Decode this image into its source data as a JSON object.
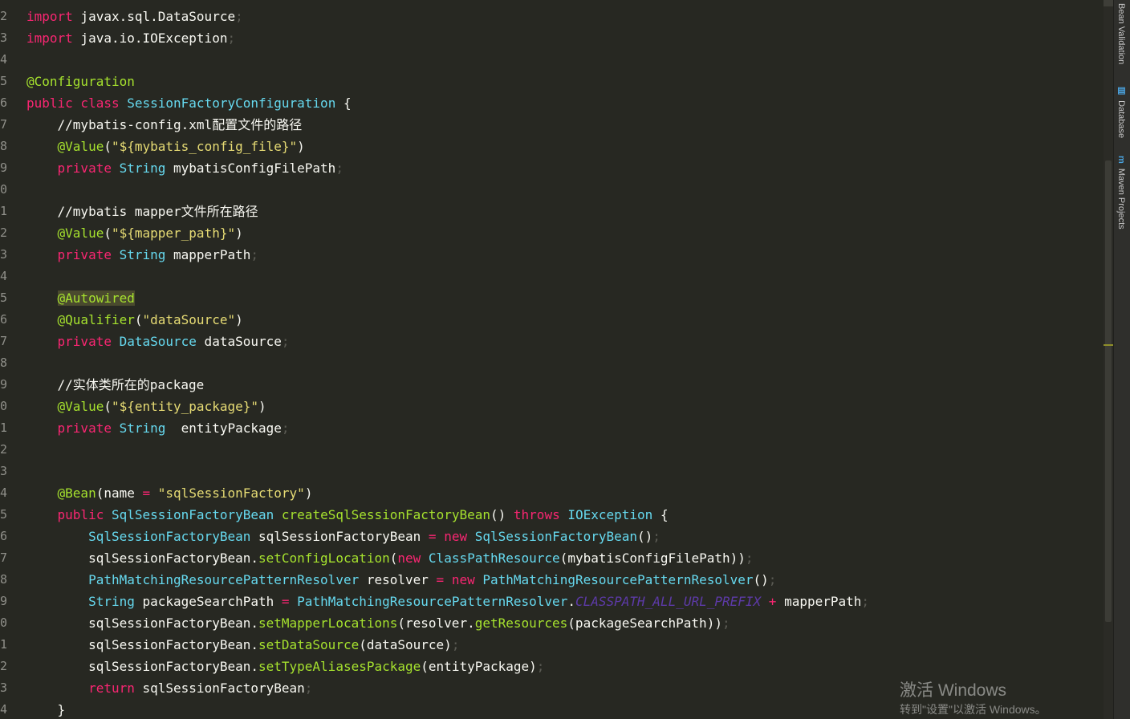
{
  "editor": {
    "lines": [
      {
        "n": "2",
        "tokens": [
          [
            "import",
            "kw"
          ],
          [
            " javax.sql.DataSource",
            "plain"
          ],
          [
            ";",
            "semi"
          ]
        ]
      },
      {
        "n": "3",
        "tokens": [
          [
            "import",
            "kw"
          ],
          [
            " java.io.IOException",
            "plain"
          ],
          [
            ";",
            "semi"
          ]
        ]
      },
      {
        "n": "4",
        "tokens": []
      },
      {
        "n": "5",
        "tokens": [
          [
            "@Configuration",
            "ann"
          ]
        ]
      },
      {
        "n": "6",
        "tokens": [
          [
            "public class ",
            "kw"
          ],
          [
            "SessionFactoryConfiguration",
            "type"
          ],
          [
            " {",
            "plain"
          ]
        ]
      },
      {
        "n": "7",
        "tokens": [
          [
            "    //mybatis-config.xml配置文件的路径",
            "cmt"
          ]
        ]
      },
      {
        "n": "8",
        "tokens": [
          [
            "    ",
            "plain"
          ],
          [
            "@Value",
            "ann"
          ],
          [
            "(",
            "plain"
          ],
          [
            "\"${mybatis_config_file}\"",
            "str"
          ],
          [
            ")",
            "plain"
          ]
        ]
      },
      {
        "n": "9",
        "tokens": [
          [
            "    ",
            "plain"
          ],
          [
            "private ",
            "kw"
          ],
          [
            "String",
            "type"
          ],
          [
            " mybatisConfigFilePath",
            "plain"
          ],
          [
            ";",
            "semi"
          ]
        ]
      },
      {
        "n": "0",
        "tokens": []
      },
      {
        "n": "1",
        "tokens": [
          [
            "    //mybatis mapper文件所在路径",
            "cmt"
          ]
        ]
      },
      {
        "n": "2",
        "tokens": [
          [
            "    ",
            "plain"
          ],
          [
            "@Value",
            "ann"
          ],
          [
            "(",
            "plain"
          ],
          [
            "\"${mapper_path}\"",
            "str"
          ],
          [
            ")",
            "plain"
          ]
        ]
      },
      {
        "n": "3",
        "tokens": [
          [
            "    ",
            "plain"
          ],
          [
            "private ",
            "kw"
          ],
          [
            "String",
            "type"
          ],
          [
            " mapperPath",
            "plain"
          ],
          [
            ";",
            "semi"
          ]
        ]
      },
      {
        "n": "4",
        "tokens": []
      },
      {
        "n": "5",
        "tokens": [
          [
            "    ",
            "plain"
          ],
          [
            "@Autowired",
            "ann-hl"
          ]
        ]
      },
      {
        "n": "6",
        "tokens": [
          [
            "    ",
            "plain"
          ],
          [
            "@Qualifier",
            "ann"
          ],
          [
            "(",
            "plain"
          ],
          [
            "\"dataSource\"",
            "str"
          ],
          [
            ")",
            "plain"
          ]
        ]
      },
      {
        "n": "7",
        "tokens": [
          [
            "    ",
            "plain"
          ],
          [
            "private ",
            "kw"
          ],
          [
            "DataSource",
            "type"
          ],
          [
            " dataSource",
            "plain"
          ],
          [
            ";",
            "semi"
          ]
        ]
      },
      {
        "n": "8",
        "tokens": []
      },
      {
        "n": "9",
        "tokens": [
          [
            "    //实体类所在的package",
            "cmt"
          ]
        ]
      },
      {
        "n": "0",
        "tokens": [
          [
            "    ",
            "plain"
          ],
          [
            "@Value",
            "ann"
          ],
          [
            "(",
            "plain"
          ],
          [
            "\"${entity_package}\"",
            "str"
          ],
          [
            ")",
            "plain"
          ]
        ]
      },
      {
        "n": "1",
        "tokens": [
          [
            "    ",
            "plain"
          ],
          [
            "private ",
            "kw"
          ],
          [
            "String",
            "type"
          ],
          [
            "  entityPackage",
            "plain"
          ],
          [
            ";",
            "semi"
          ]
        ]
      },
      {
        "n": "2",
        "tokens": []
      },
      {
        "n": "3",
        "tokens": []
      },
      {
        "n": "4",
        "tokens": [
          [
            "    ",
            "plain"
          ],
          [
            "@Bean",
            "ann"
          ],
          [
            "(name ",
            "plain"
          ],
          [
            "=",
            "op"
          ],
          [
            " ",
            "plain"
          ],
          [
            "\"sqlSessionFactory\"",
            "str"
          ],
          [
            ")",
            "plain"
          ]
        ]
      },
      {
        "n": "5",
        "tokens": [
          [
            "    ",
            "plain"
          ],
          [
            "public ",
            "kw"
          ],
          [
            "SqlSessionFactoryBean",
            "type"
          ],
          [
            " ",
            "plain"
          ],
          [
            "createSqlSessionFactoryBean",
            "method"
          ],
          [
            "() ",
            "plain"
          ],
          [
            "throws ",
            "kw"
          ],
          [
            "IOException",
            "type"
          ],
          [
            " {",
            "plain"
          ]
        ]
      },
      {
        "n": "6",
        "tokens": [
          [
            "        ",
            "plain"
          ],
          [
            "SqlSessionFactoryBean",
            "type"
          ],
          [
            " sqlSessionFactoryBean ",
            "plain"
          ],
          [
            "=",
            "op"
          ],
          [
            " ",
            "plain"
          ],
          [
            "new ",
            "kw"
          ],
          [
            "SqlSessionFactoryBean",
            "type"
          ],
          [
            "()",
            "plain"
          ],
          [
            ";",
            "semi"
          ]
        ]
      },
      {
        "n": "7",
        "tokens": [
          [
            "        sqlSessionFactoryBean.",
            "plain"
          ],
          [
            "setConfigLocation",
            "method"
          ],
          [
            "(",
            "plain"
          ],
          [
            "new ",
            "kw"
          ],
          [
            "ClassPathResource",
            "type"
          ],
          [
            "(mybatisConfigFilePath))",
            "plain"
          ],
          [
            ";",
            "semi"
          ]
        ]
      },
      {
        "n": "8",
        "tokens": [
          [
            "        ",
            "plain"
          ],
          [
            "PathMatchingResourcePatternResolver",
            "type"
          ],
          [
            " resolver ",
            "plain"
          ],
          [
            "=",
            "op"
          ],
          [
            " ",
            "plain"
          ],
          [
            "new ",
            "kw"
          ],
          [
            "PathMatchingResourcePatternResolver",
            "type"
          ],
          [
            "()",
            "plain"
          ],
          [
            ";",
            "semi"
          ]
        ]
      },
      {
        "n": "9",
        "tokens": [
          [
            "        ",
            "plain"
          ],
          [
            "String",
            "type"
          ],
          [
            " packageSearchPath ",
            "plain"
          ],
          [
            "=",
            "op"
          ],
          [
            " ",
            "plain"
          ],
          [
            "PathMatchingResourcePatternResolver",
            "type"
          ],
          [
            ".",
            "plain"
          ],
          [
            "CLASSPATH_ALL_URL_PREFIX",
            "const"
          ],
          [
            " ",
            "plain"
          ],
          [
            "+",
            "op"
          ],
          [
            " mapperPath",
            "plain"
          ],
          [
            ";",
            "semi"
          ]
        ]
      },
      {
        "n": "0",
        "tokens": [
          [
            "        sqlSessionFactoryBean.",
            "plain"
          ],
          [
            "setMapperLocations",
            "method"
          ],
          [
            "(resolver.",
            "plain"
          ],
          [
            "getResources",
            "method"
          ],
          [
            "(packageSearchPath))",
            "plain"
          ],
          [
            ";",
            "semi"
          ]
        ]
      },
      {
        "n": "1",
        "tokens": [
          [
            "        sqlSessionFactoryBean.",
            "plain"
          ],
          [
            "setDataSource",
            "method"
          ],
          [
            "(dataSource)",
            "plain"
          ],
          [
            ";",
            "semi"
          ]
        ]
      },
      {
        "n": "2",
        "tokens": [
          [
            "        sqlSessionFactoryBean.",
            "plain"
          ],
          [
            "setTypeAliasesPackage",
            "method"
          ],
          [
            "(entityPackage)",
            "plain"
          ],
          [
            ";",
            "semi"
          ]
        ]
      },
      {
        "n": "3",
        "tokens": [
          [
            "        ",
            "plain"
          ],
          [
            "return ",
            "kw"
          ],
          [
            "sqlSessionFactoryBean",
            "plain"
          ],
          [
            ";",
            "semi"
          ]
        ]
      },
      {
        "n": "4",
        "tokens": [
          [
            "    }",
            "plain"
          ]
        ]
      }
    ]
  },
  "side_panel": {
    "tabs": [
      {
        "label": "Bean Validation",
        "icon": ""
      },
      {
        "label": "Database",
        "icon": "▤"
      },
      {
        "label": "Maven Projects",
        "icon": "m"
      }
    ]
  },
  "watermark": {
    "title": "激活 Windows",
    "subtitle": "转到\"设置\"以激活 Windows。"
  },
  "colors": {
    "background": "#272822",
    "keyword": "#f92672",
    "type": "#66d9ef",
    "annotation": "#a6e22e",
    "string": "#e6db74"
  }
}
